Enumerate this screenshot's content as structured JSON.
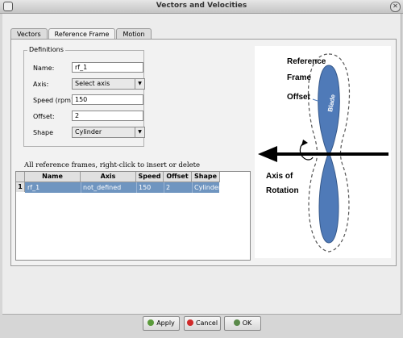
{
  "window": {
    "title": "Vectors and Velocities"
  },
  "tabs": [
    {
      "label": "Vectors"
    },
    {
      "label": "Reference Frame"
    },
    {
      "label": "Motion"
    }
  ],
  "definitions": {
    "legend": "Definitions",
    "name": {
      "label": "Name:",
      "value": "rf_1"
    },
    "axis": {
      "label": "Axis:",
      "value": "Select axis"
    },
    "speed": {
      "label": "Speed (rpm):",
      "value": "150"
    },
    "offset": {
      "label": "Offset:",
      "value": "2"
    },
    "shape": {
      "label": "Shape",
      "value": "Cylinder"
    }
  },
  "table": {
    "caption": "All reference frames, right-click to insert or delete",
    "columns": [
      "Name",
      "Axis",
      "Speed",
      "Offset",
      "Shape"
    ],
    "rows": [
      {
        "index": "1",
        "cells": [
          "rf_1",
          "not_defined",
          "150",
          "2",
          "Cylinder"
        ]
      }
    ]
  },
  "diagram": {
    "reference_label_1": "Reference",
    "reference_label_2": "Frame",
    "offset_label": "Offset",
    "blade_label": "Blade",
    "axis_label_1": "Axis of",
    "axis_label_2": "Rotation"
  },
  "buttons": {
    "apply": "Apply",
    "cancel": "Cancel",
    "ok": "OK"
  },
  "colors": {
    "selection": "#6f95c0",
    "blade": "#4f7ab8"
  }
}
